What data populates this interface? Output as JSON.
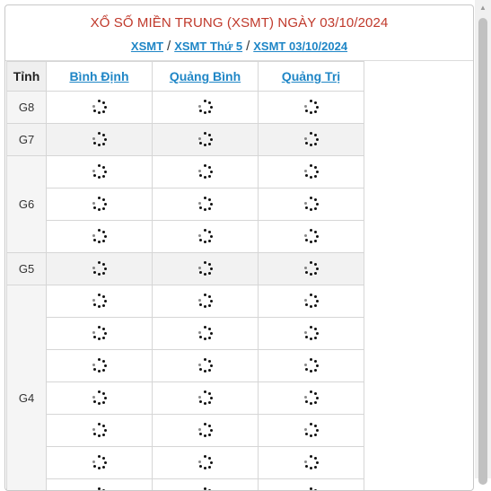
{
  "header": {
    "title": "XỔ SỐ MIỀN TRUNG (XSMT) NGÀY 03/10/2024",
    "breadcrumbs": [
      "XSMT",
      "XSMT Thứ 5",
      "XSMT 03/10/2024"
    ],
    "separator": "/"
  },
  "table": {
    "corner_label": "Tỉnh",
    "provinces": [
      "Bình Định",
      "Quảng Bình",
      "Quảng Trị"
    ],
    "prizes": [
      {
        "label": "G8",
        "rows": 1,
        "shaded": false
      },
      {
        "label": "G7",
        "rows": 1,
        "shaded": true
      },
      {
        "label": "G6",
        "rows": 3,
        "shaded": false
      },
      {
        "label": "G5",
        "rows": 1,
        "shaded": true
      },
      {
        "label": "G4",
        "rows": 7,
        "shaded": false
      }
    ],
    "cell_icon": "loading-spinner-icon"
  },
  "colors": {
    "title": "#c0392b",
    "link": "#1f86c6"
  }
}
